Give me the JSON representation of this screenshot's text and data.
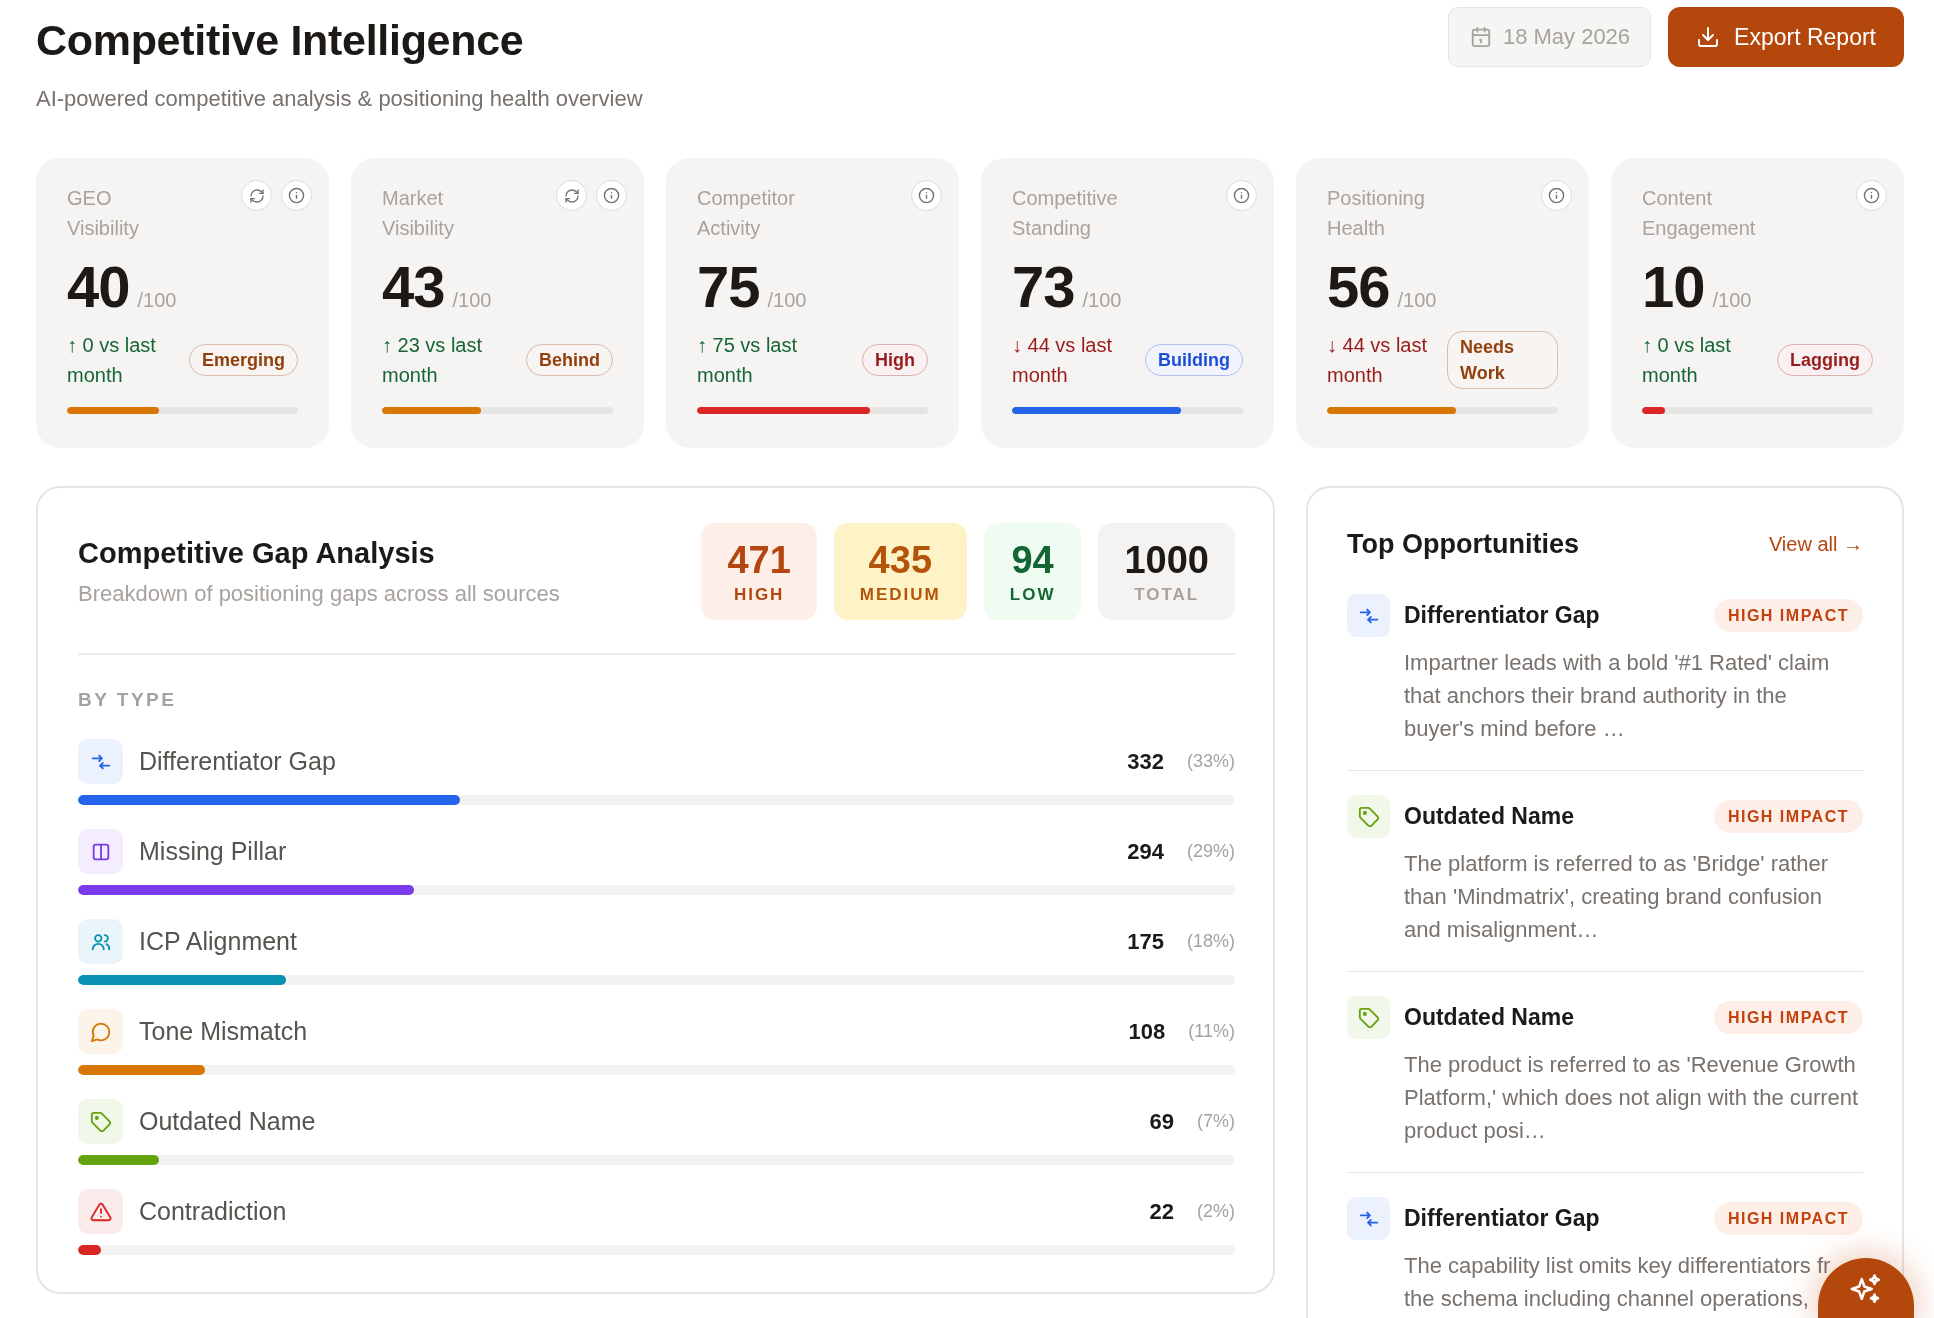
{
  "header": {
    "title": "Competitive Intelligence",
    "subtitle": "AI-powered competitive analysis & positioning health overview",
    "date": "18 May 2026",
    "export_button": "Export Report"
  },
  "metrics": [
    {
      "label": "GEO Visibility",
      "refresh": true,
      "score": "40",
      "max": "/100",
      "change": "↑ 0 vs last month",
      "rising": true,
      "badge": {
        "text": "Emerging",
        "color": "#92400e"
      },
      "level": 0.4,
      "color": "#d97706"
    },
    {
      "label": "Market Visibility",
      "refresh": true,
      "score": "43",
      "max": "/100",
      "change": "↑ 23 vs last month",
      "rising": true,
      "badge": {
        "text": "Behind",
        "color": "#92400e"
      },
      "level": 0.43,
      "color": "#d97706"
    },
    {
      "label": "Competitor Activity",
      "refresh": false,
      "score": "75",
      "max": "/100",
      "change": "↑ 75 vs last month",
      "rising": true,
      "badge": {
        "text": "High",
        "color": "#991b1b"
      },
      "level": 0.75,
      "color": "#dc2626"
    },
    {
      "label": "Competitive Standing",
      "refresh": false,
      "score": "73",
      "max": "/100",
      "change": "↓ 44 vs last month",
      "rising": false,
      "badge": {
        "text": "Building",
        "color": "#1d4ed8"
      },
      "level": 0.73,
      "color": "#2563eb"
    },
    {
      "label": "Positioning Health",
      "refresh": false,
      "score": "56",
      "max": "/100",
      "change": "↓ 44 vs last month",
      "rising": false,
      "badge": {
        "text": "Needs Work",
        "color": "#92400e"
      },
      "level": 0.56,
      "color": "#d97706"
    },
    {
      "label": "Content Engagement",
      "refresh": false,
      "score": "10",
      "max": "/100",
      "change": "↑ 0 vs last month",
      "rising": true,
      "badge": {
        "text": "Lagging",
        "color": "#991b1b"
      },
      "level": 0.1,
      "color": "#dc2626"
    }
  ],
  "gap_analysis": {
    "title": "Competitive Gap Analysis",
    "subtitle": "Breakdown of positioning gaps across all sources",
    "stats": [
      {
        "kind": "high",
        "value": "471",
        "label": "HIGH"
      },
      {
        "kind": "medium",
        "value": "435",
        "label": "MEDIUM"
      },
      {
        "kind": "low",
        "value": "94",
        "label": "LOW"
      },
      {
        "kind": "total",
        "value": "1000",
        "label": "TOTAL"
      }
    ],
    "section_label": "BY TYPE",
    "rows": [
      {
        "kind": "differentiator",
        "label": "Differentiator Gap",
        "count": "332",
        "percent": "(33%)",
        "level": 0.33,
        "color": "#2563eb"
      },
      {
        "kind": "pillar",
        "label": "Missing Pillar",
        "count": "294",
        "percent": "(29%)",
        "level": 0.29,
        "color": "#7c3aed"
      },
      {
        "kind": "icp",
        "label": "ICP Alignment",
        "count": "175",
        "percent": "(18%)",
        "level": 0.18,
        "color": "#0891b2"
      },
      {
        "kind": "tone",
        "label": "Tone Mismatch",
        "count": "108",
        "percent": "(11%)",
        "level": 0.11,
        "color": "#d97706"
      },
      {
        "kind": "outdated",
        "label": "Outdated Name",
        "count": "69",
        "percent": "(7%)",
        "level": 0.07,
        "color": "#65a30d"
      },
      {
        "kind": "contradiction",
        "label": "Contradiction",
        "count": "22",
        "percent": "(2%)",
        "level": 0.02,
        "color": "#dc2626"
      }
    ]
  },
  "opportunities": {
    "title": "Top Opportunities",
    "link": "View all →",
    "items": [
      {
        "kind": "differentiator",
        "title": "Differentiator Gap",
        "impact": "HIGH IMPACT",
        "text": "Impartner leads with a bold '#1 Rated' claim that anchors their brand authority in the buyer's mind before …"
      },
      {
        "kind": "outdated",
        "title": "Outdated Name",
        "impact": "HIGH IMPACT",
        "text": "The platform is referred to as 'Bridge' rather than 'Mindmatrix', creating brand confusion and misalignment…"
      },
      {
        "kind": "outdated",
        "title": "Outdated Name",
        "impact": "HIGH IMPACT",
        "text": "The product is referred to as 'Revenue Growth Platform,' which does not align with the current product posi…"
      },
      {
        "kind": "differentiator",
        "title": "Differentiator Gap",
        "impact": "HIGH IMPACT",
        "text": "The capability list omits key differentiators fr the schema including channel operations,"
      }
    ]
  }
}
